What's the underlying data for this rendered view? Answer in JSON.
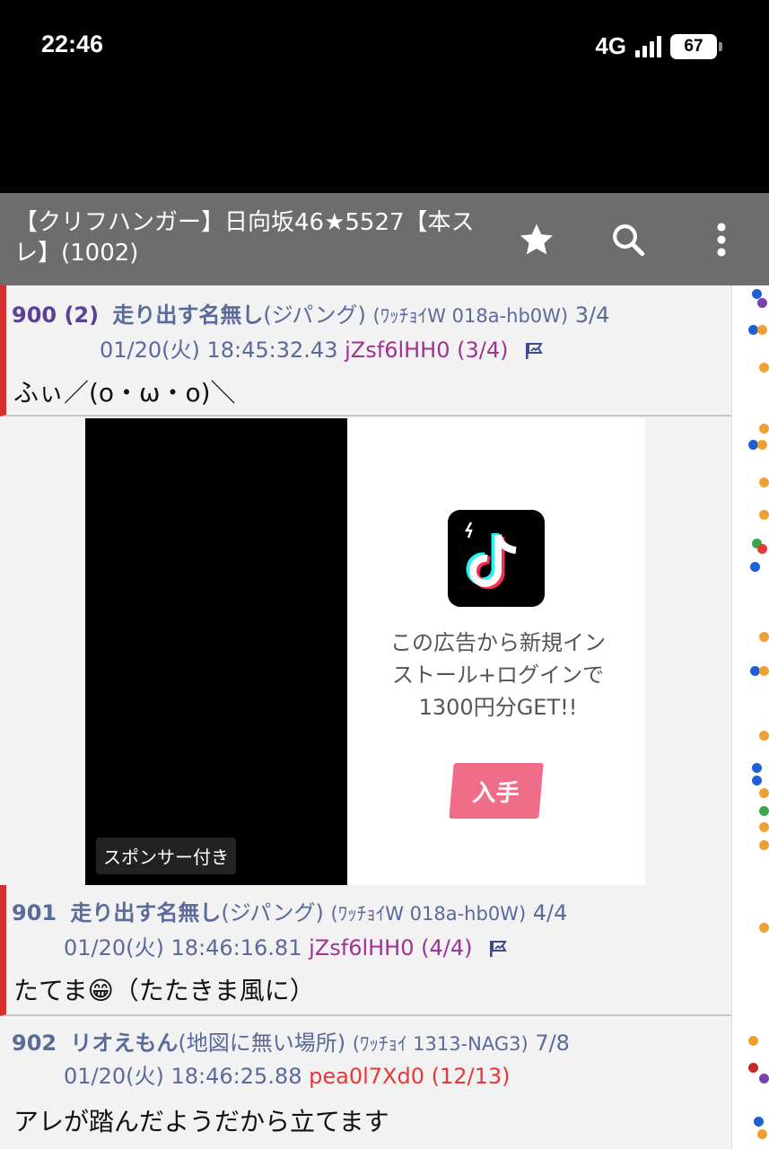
{
  "status_bar": {
    "time": "22:46",
    "network": "4G",
    "battery": "67"
  },
  "app_bar": {
    "title": "【クリフハンガー】日向坂46★5527【本スレ】(1002)"
  },
  "posts": [
    {
      "number": "900 (2)",
      "name": "走り出す名無し",
      "location": "(ジパング)",
      "trip": "(ﾜｯﾁｮｲW 018a-hb0W)",
      "count": "3/4",
      "date": "01/20(火) 18:45:32.43",
      "id": "jZsf6lHH0 (3/4)",
      "body": "ふぃ／(o・ω・o)＼"
    },
    {
      "number": "901",
      "name": "走り出す名無し",
      "location": "(ジパング)",
      "trip": "(ﾜｯﾁｮｲW 018a-hb0W)",
      "count": "4/4",
      "date": "01/20(火) 18:46:16.81",
      "id": "jZsf6lHH0 (4/4)",
      "body": "たてま😁（たたきま風に）"
    },
    {
      "number": "902",
      "name": "リオえもん",
      "location": "(地図に無い場所)",
      "trip": "(ﾜｯﾁｮｲ 1313-NAG3)",
      "count": "7/8",
      "date": "01/20(火) 18:46:25.88",
      "id": "pea0l7Xd0 (12/13)",
      "body": "アレが踏んだようだから立てます"
    }
  ],
  "ad": {
    "sponsor_label": "スポンサー付き",
    "copy_line1": "この広告から新規イン",
    "copy_line2": "ストール+ログインで",
    "copy_line3": "1300円分GET!!",
    "cta": "入手"
  },
  "colors": {
    "app_bar": "#6d6d6d",
    "post_number": "#5b3f99",
    "name": "#5a6a9b",
    "id_purple": "#a03294",
    "id_red": "#e53935",
    "marker": "#d32f2f",
    "cta": "#f06d8a"
  }
}
